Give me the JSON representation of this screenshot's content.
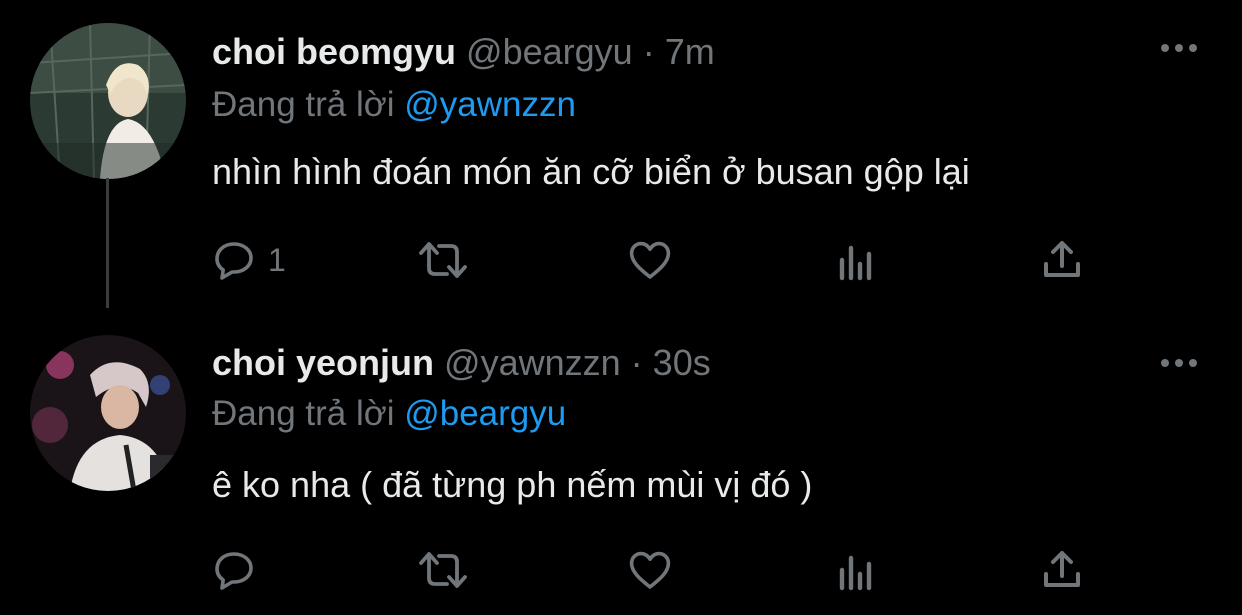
{
  "colors": {
    "background": "#000000",
    "text": "#e7e9ea",
    "muted": "#71767b",
    "mention": "#1d9bf0",
    "thread": "#3a3d40"
  },
  "tweets": [
    {
      "name": "choi beomgyu",
      "handle": "@beargyu",
      "separator": "·",
      "time": "7m",
      "reply_prefix": "Đang trả lời",
      "reply_to": "@yawnzzn",
      "text": "nhìn hình đoán món ăn cỡ biển ở busan gộp lại",
      "reply_count": "1",
      "icons": [
        "reply-icon",
        "retweet-icon",
        "like-icon",
        "analytics-icon",
        "share-icon",
        "more-icon"
      ]
    },
    {
      "name": "choi yeonjun",
      "handle": "@yawnzzn",
      "separator": "·",
      "time": "30s",
      "reply_prefix": "Đang trả lời",
      "reply_to": "@beargyu",
      "text": "ê ko nha ( đã từng ph nếm mùi vị đó )",
      "reply_count": "",
      "icons": [
        "reply-icon",
        "retweet-icon",
        "like-icon",
        "analytics-icon",
        "share-icon",
        "more-icon"
      ]
    }
  ]
}
